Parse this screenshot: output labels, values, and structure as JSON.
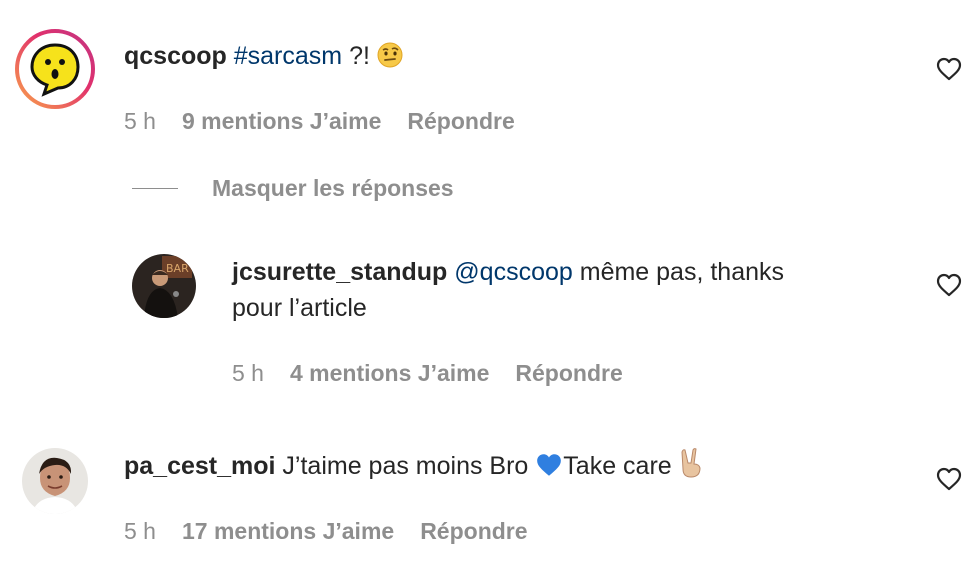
{
  "comments": [
    {
      "username": "qcscoop",
      "hashtag": "#sarcasm",
      "text_after": " ?! ",
      "emoji": "raised-eyebrow-emoji",
      "time": "5 h",
      "likes": "9 mentions J’aime",
      "reply": "Répondre"
    },
    {
      "username": "jcsurette_standup",
      "mention": "@qcscoop",
      "text_line1": " même pas, thanks",
      "text_line2": "pour l’article",
      "time": "5 h",
      "likes": "4 mentions J’aime",
      "reply": "Répondre"
    },
    {
      "username": "pa_cest_moi",
      "text": " J’taime pas moins Bro ",
      "text_after_heart": "Take care ",
      "emoji_heart": "blue-heart-emoji",
      "emoji_end": "victory-hand-emoji",
      "time": "5 h",
      "likes": "17 mentions J’aime",
      "reply": "Répondre"
    }
  ],
  "replies_toggle": {
    "label": "Masquer les réponses"
  },
  "colors": {
    "text": "#262626",
    "meta": "#8e8e8e",
    "link": "#00376b",
    "story_ring_start": "#f9a24b",
    "story_ring_end": "#c13584"
  },
  "icons": {
    "like": "heart-outline-icon"
  }
}
